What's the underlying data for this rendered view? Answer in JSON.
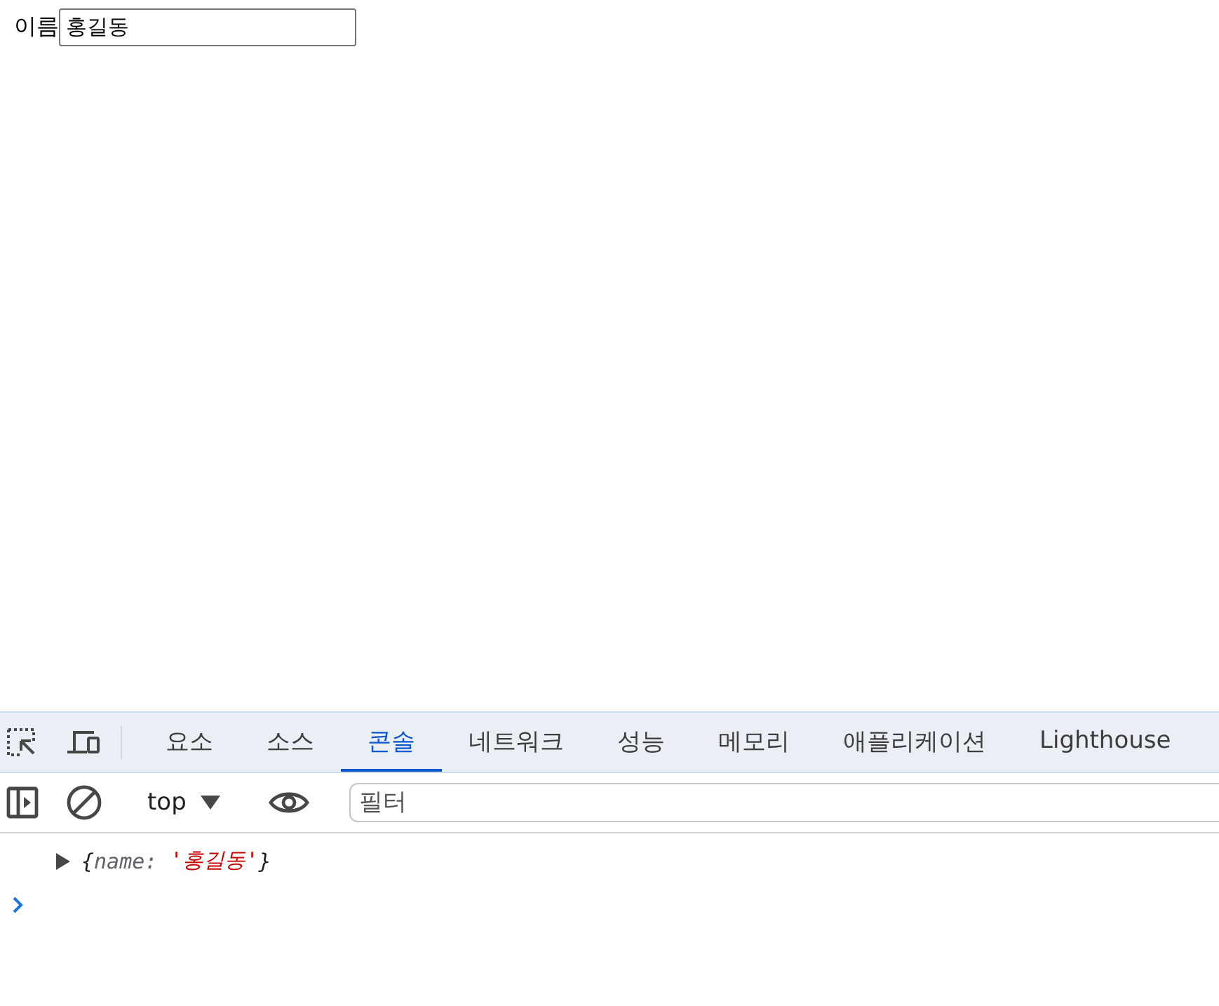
{
  "page": {
    "label": "이름",
    "input_value": "홍길동"
  },
  "devtools": {
    "tabs": [
      {
        "label": "요소",
        "selected": false
      },
      {
        "label": "소스",
        "selected": false
      },
      {
        "label": "콘솔",
        "selected": true
      },
      {
        "label": "네트워크",
        "selected": false
      },
      {
        "label": "성능",
        "selected": false
      },
      {
        "label": "메모리",
        "selected": false
      },
      {
        "label": "애플리케이션",
        "selected": false
      },
      {
        "label": "Lighthouse",
        "selected": false
      }
    ],
    "context": "top",
    "filter": {
      "placeholder": "필터"
    },
    "log": [
      {
        "open": "{",
        "key": "name:",
        "value": "'홍길동'",
        "close": "}",
        "expanded": false
      }
    ]
  }
}
